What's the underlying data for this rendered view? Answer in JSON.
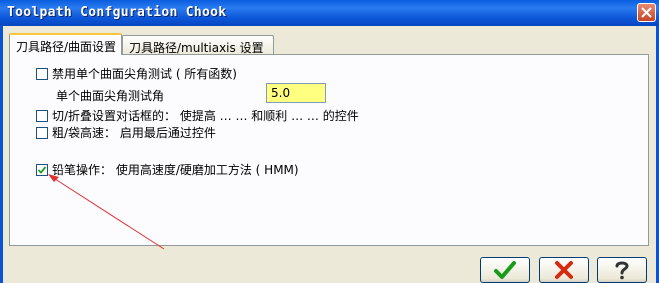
{
  "window": {
    "title": "Toolpath Confguration Chook"
  },
  "tabs": [
    {
      "label": "刀具路径/曲面设置"
    },
    {
      "label": "刀具路径/multiaxis 设置"
    }
  ],
  "options": {
    "disable_sharp_test": {
      "label": "禁用单个曲面尖角测试 ( 所有函数)",
      "checked": false
    },
    "sharp_angle": {
      "label": "单个曲面尖角测试角",
      "value": "5.0"
    },
    "cut_fold": {
      "label": "切/折叠设置对话框的： 使提高 … … 和顺利 … … 的控件",
      "checked": false
    },
    "rough_high_speed": {
      "label": "粗/袋高速： 启用最后通过控件",
      "checked": false
    },
    "pencil": {
      "label": "铅笔操作： 使用高速度/硬磨加工方法 ( HMM)",
      "checked": true
    }
  },
  "buttons": {
    "ok_icon": "check-icon",
    "cancel_icon": "x-icon",
    "help_icon": "question-icon"
  },
  "colors": {
    "input_background": "#ffff80",
    "arrow": "#e03030",
    "ok_icon": "#1a9a1a",
    "cancel_icon": "#d42a10"
  }
}
